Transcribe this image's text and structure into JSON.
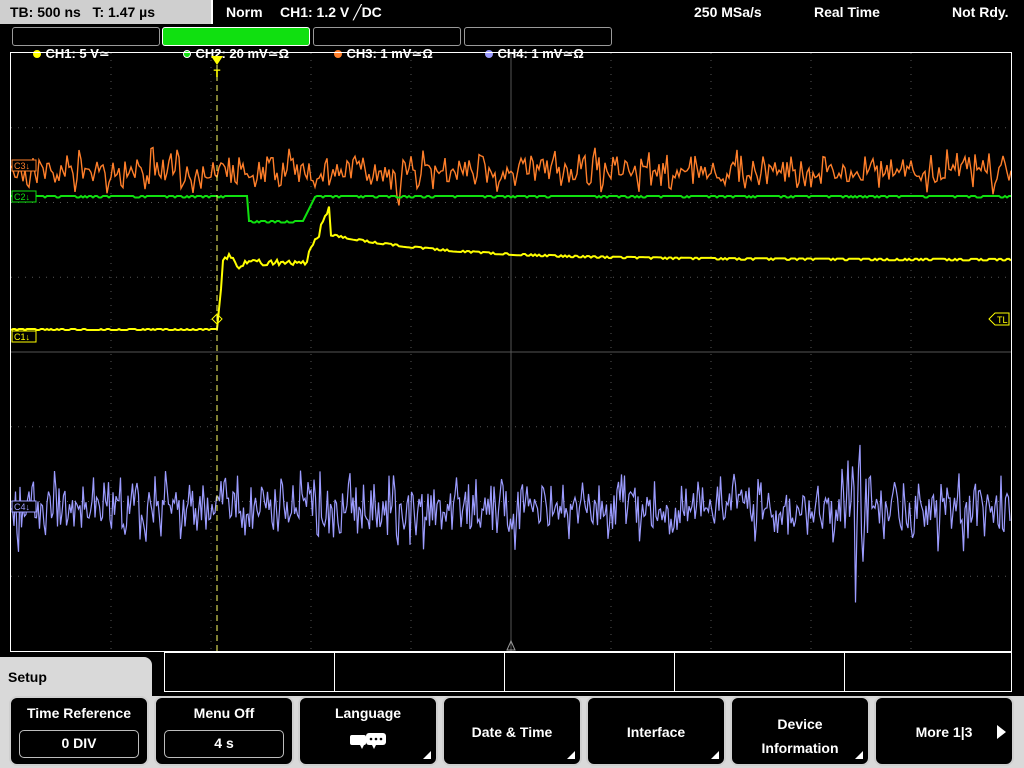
{
  "topbar": {
    "timebase": "TB: 500 ns   T: 1.47 µs",
    "mode": "Norm",
    "trigger": "CH1: 1.2 V ╱DC",
    "sample_rate": "250 MSa/s",
    "acq_mode": "Real Time",
    "status": "Not Rdy."
  },
  "channels": [
    {
      "label": "CH1: 5 V≃",
      "color": "#ffff00",
      "active": false
    },
    {
      "label": "CH2: 20 mV≃Ω",
      "color": "#10e010",
      "active": true
    },
    {
      "label": "CH3: 1 mV≃Ω",
      "color": "#ff7f2a",
      "active": false
    },
    {
      "label": "CH4: 1 mV≃Ω",
      "color": "#9c9cff",
      "active": false
    }
  ],
  "markers": {
    "c1": "C1↓",
    "c2": "C2↓",
    "c3": "C3↓",
    "c4": "C4↓",
    "trigger_level": "TL",
    "trigger_pos": "T"
  },
  "menu": {
    "title": "Setup",
    "softkeys": [
      {
        "label": "Time Reference",
        "value": "0 DIV"
      },
      {
        "label": "Menu Off",
        "value": "4 s"
      },
      {
        "label": "Language",
        "icon": "speech-bubbles-icon"
      },
      {
        "label": "Date & Time"
      },
      {
        "label": "Interface"
      },
      {
        "label": "Device Information"
      },
      {
        "label": "More 1|3"
      }
    ]
  }
}
